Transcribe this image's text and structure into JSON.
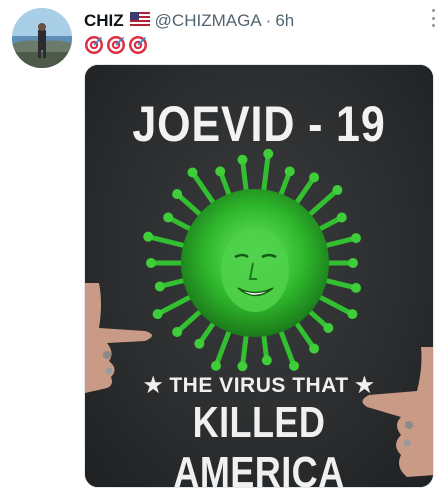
{
  "tweet": {
    "display_name": "CHIZ",
    "handle": "@CHIZMAGA",
    "separator": "·",
    "timestamp": "6h",
    "emoji_icons": [
      "target-icon",
      "target-icon",
      "target-icon"
    ]
  },
  "media": {
    "headline": "JOEVID - 19",
    "caption_line1": "★ THE VIRUS THAT ★",
    "caption_line2": "KILLED AMERICA"
  },
  "colors": {
    "shirt": "#2f3133",
    "virus_green": "#3fce3a",
    "text_muted": "#536471"
  }
}
